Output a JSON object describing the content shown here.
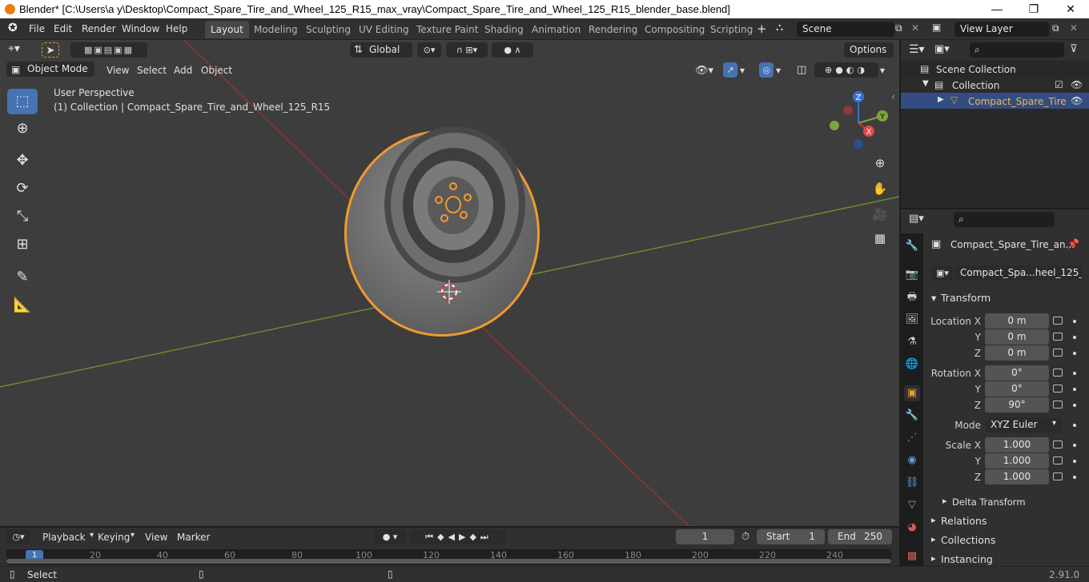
{
  "window": {
    "title": "Blender* [C:\\Users\\a y\\Desktop\\Compact_Spare_Tire_and_Wheel_125_R15_max_vray\\Compact_Spare_Tire_and_Wheel_125_R15_blender_base.blend]",
    "minimize": "—",
    "maximize": "❐",
    "close": "✕"
  },
  "menu": [
    "File",
    "Edit",
    "Render",
    "Window",
    "Help"
  ],
  "workspaces": [
    "Layout",
    "Modeling",
    "Sculpting",
    "UV Editing",
    "Texture Paint",
    "Shading",
    "Animation",
    "Rendering",
    "Compositing",
    "Scripting"
  ],
  "workspace_add": "+",
  "scene": {
    "label": "Scene"
  },
  "view_layer": {
    "label": "View Layer"
  },
  "viewport": {
    "mode": "Object Mode",
    "menus": [
      "View",
      "Select",
      "Add",
      "Object"
    ],
    "transform_orientation": "Global",
    "options": "Options",
    "overlay_title": "User Perspective",
    "overlay_subtitle": "(1) Collection | Compact_Spare_Tire_and_Wheel_125_R15",
    "gizmo": {
      "x": "X",
      "y": "Y",
      "z": "Z"
    }
  },
  "outliner": {
    "scene_collection": "Scene Collection",
    "collection": "Collection",
    "object": "Compact_Spare_Tire"
  },
  "properties": {
    "object_name": "Compact_Spare_Tire_an...",
    "data_name": "Compact_Spa...heel_125_R15",
    "transform": {
      "title": "Transform",
      "location_label": "Location X",
      "rotation_label": "Rotation X",
      "scale_label": "Scale X",
      "y_label": "Y",
      "z_label": "Z",
      "location": [
        "0 m",
        "0 m",
        "0 m"
      ],
      "rotation": [
        "0°",
        "0°",
        "90°"
      ],
      "mode_label": "Mode",
      "mode": "XYZ Euler",
      "scale": [
        "1.000",
        "1.000",
        "1.000"
      ],
      "delta": "Delta Transform"
    },
    "relations": "Relations",
    "collections": "Collections",
    "instancing": "Instancing"
  },
  "timeline": {
    "menus": [
      "Playback",
      "Keying",
      "View",
      "Marker"
    ],
    "current_frame": "1",
    "start_label": "Start",
    "start": "1",
    "end_label": "End",
    "end": "250",
    "ruler": [
      "1",
      "20",
      "40",
      "60",
      "80",
      "100",
      "120",
      "140",
      "160",
      "180",
      "200",
      "220",
      "240"
    ]
  },
  "status": {
    "select": "Select",
    "version": "2.91.0"
  },
  "colors": {
    "accent": "#4772b3",
    "selection_orange": "#f29a2e",
    "axis_x": "#c8403e",
    "axis_y": "#7fa33a",
    "axis_z": "#3a6fcf"
  }
}
